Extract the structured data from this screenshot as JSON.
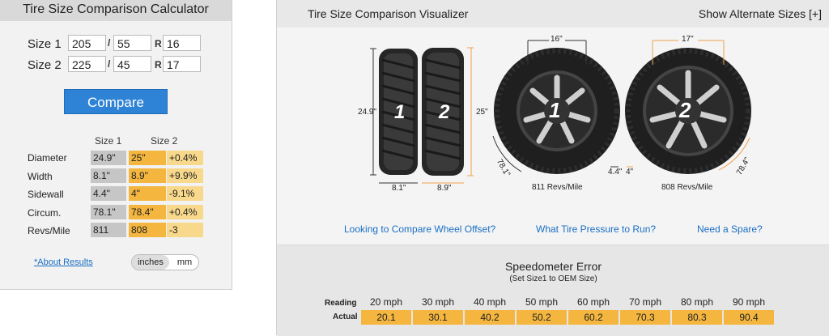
{
  "calculator": {
    "title": "Tire Size Comparison Calculator",
    "size1_label": "Size 1",
    "size2_label": "Size 2",
    "size1": {
      "width": "205",
      "aspect": "55",
      "rim": "16"
    },
    "size2": {
      "width": "225",
      "aspect": "45",
      "rim": "17"
    },
    "slash": "/",
    "r_label": "R",
    "compare_label": "Compare",
    "col_size1": "Size 1",
    "col_size2": "Size 2",
    "rows": [
      {
        "label": "Diameter",
        "s1": "24.9\"",
        "s2": "25\"",
        "diff": "+0.4%"
      },
      {
        "label": "Width",
        "s1": "8.1\"",
        "s2": "8.9\"",
        "diff": "+9.9%"
      },
      {
        "label": "Sidewall",
        "s1": "4.4\"",
        "s2": "4\"",
        "diff": "-9.1%"
      },
      {
        "label": "Circum.",
        "s1": "78.1\"",
        "s2": "78.4\"",
        "diff": "+0.4%"
      },
      {
        "label": "Revs/Mile",
        "s1": "811",
        "s2": "808",
        "diff": "-3"
      }
    ],
    "about_link": "*About Results",
    "unit_inches": "inches",
    "unit_mm": "mm"
  },
  "visualizer": {
    "title": "Tire Size Comparison Visualizer",
    "alt_sizes": "Show Alternate Sizes [+]",
    "tread1_number": "1",
    "tread2_number": "2",
    "diam1": "24.9\"",
    "diam2": "25\"",
    "width1": "8.1\"",
    "width2": "8.9\"",
    "rim1": "16\"",
    "rim2": "17\"",
    "circ1": "78.1\"",
    "circ2": "78.4\"",
    "side1": "4.4\"",
    "side2": "4\"",
    "revs1": "811 Revs/Mile",
    "revs2": "808 Revs/Mile",
    "links": {
      "offset": "Looking to Compare Wheel Offset?",
      "pressure": "What Tire Pressure to Run?",
      "spare": "Need a Spare?"
    }
  },
  "speedometer": {
    "title": "Speedometer Error",
    "subtitle": "(Set Size1 to OEM Size)",
    "reading_label": "Reading",
    "actual_label": "Actual",
    "reading": [
      "20 mph",
      "30 mph",
      "40 mph",
      "50 mph",
      "60 mph",
      "70 mph",
      "80 mph",
      "90 mph"
    ],
    "actual": [
      "20.1",
      "30.1",
      "40.2",
      "50.2",
      "60.2",
      "70.3",
      "80.3",
      "90.4"
    ]
  },
  "colors": {
    "accent_button": "#2f83d6",
    "size2_cell": "#f4b63f",
    "diff_cell": "#f8d88a",
    "size1_cell": "#c6c6c6",
    "link": "#1a6fc4",
    "dimension_line": "#f0a050"
  }
}
